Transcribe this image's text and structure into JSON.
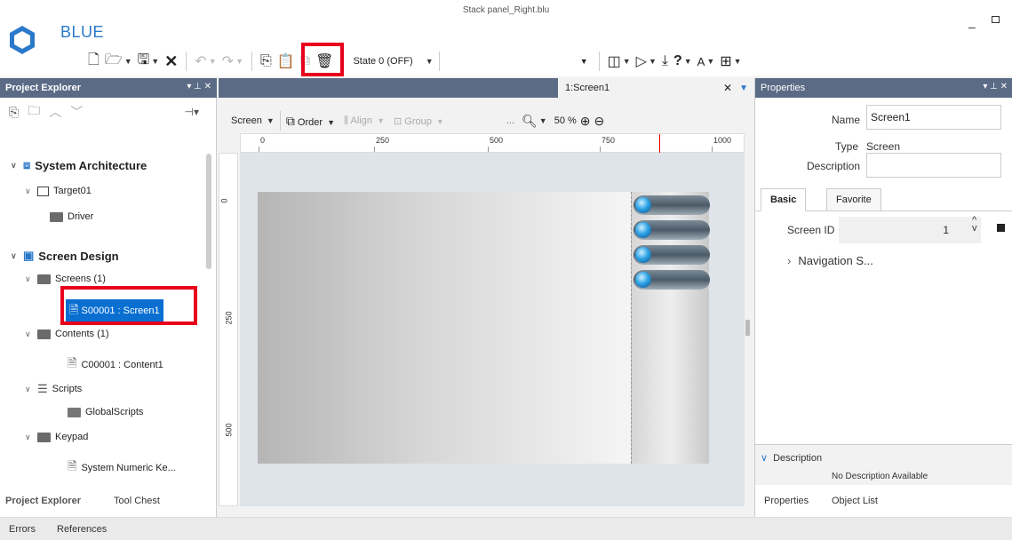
{
  "app": {
    "title": "BLUE",
    "file_title": "Stack panel_Right.blu"
  },
  "toolbar": {
    "state_label": "State 0 (OFF)"
  },
  "explorer": {
    "title": "Project Explorer",
    "items": [
      {
        "label": "System Architecture"
      },
      {
        "label": "Target01"
      },
      {
        "label": "Driver"
      },
      {
        "label": "Screen Design"
      },
      {
        "label": "Screens (1)"
      },
      {
        "label": "S00001 : Screen1"
      },
      {
        "label": "Contents (1)"
      },
      {
        "label": "C00001 : Content1"
      },
      {
        "label": "Scripts"
      },
      {
        "label": "GlobalScripts"
      },
      {
        "label": "Keypad"
      },
      {
        "label": "System Numeric Ke..."
      }
    ],
    "tabs": [
      "Project Explorer",
      "Tool Chest"
    ]
  },
  "editor": {
    "doc_tab": "1:Screen1",
    "screen_dropdown": "Screen",
    "order": "Order",
    "align": "Align",
    "group": "Group",
    "zoom": "50 %",
    "ellipsis": "...",
    "ruler_h": [
      "0",
      "250",
      "500",
      "750",
      "1000"
    ],
    "ruler_v": [
      "0",
      "250",
      "500"
    ]
  },
  "properties": {
    "title": "Properties",
    "name_label": "Name",
    "name_value": "Screen1",
    "type_label": "Type",
    "type_value": "Screen",
    "description_label": "Description",
    "tabs": [
      "Basic",
      "Favorite"
    ],
    "screen_id_label": "Screen ID",
    "screen_id_value": "1",
    "navigation": "Navigation S...",
    "description_section": "Description",
    "no_description": "No Description Available",
    "bottom_tabs": [
      "Properties",
      "Object List"
    ]
  },
  "status": {
    "tabs": [
      "Errors",
      "References"
    ]
  }
}
